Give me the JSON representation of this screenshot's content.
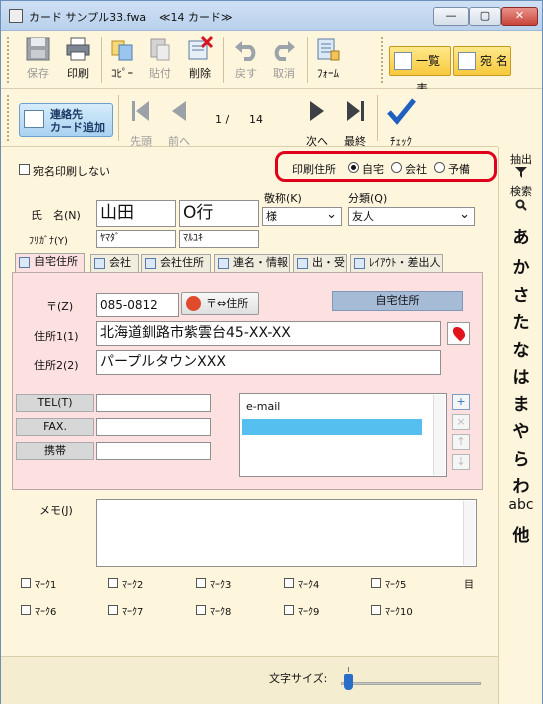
{
  "window": {
    "title": "カード サンプル33.fwa",
    "deck_label": "≪14 カード≫",
    "minimize_label": "—",
    "maximize_label": "▢",
    "close_label": "✕"
  },
  "toolbar": {
    "save": "保存",
    "print": "印刷",
    "copy": "ｺﾋﾟｰ",
    "paste": "貼付",
    "delete": "削除",
    "undo": "戻す",
    "cancel": "取消",
    "form": "ﾌｫｰﾑ",
    "list_view": "一覧表",
    "addressee": "宛 名"
  },
  "nav": {
    "add_card": "連絡先\nカード追加",
    "first": "先頭",
    "prev": "前へ",
    "position": "1 /",
    "total": "14",
    "next": "次へ",
    "last": "最終",
    "check": "ﾁｪｯｸ"
  },
  "rightbar": {
    "extract": "抽出",
    "search": "検索",
    "kana": [
      "あ",
      "か",
      "さ",
      "た",
      "な",
      "は",
      "ま",
      "や",
      "ら",
      "わ",
      "abc",
      "他"
    ]
  },
  "form": {
    "no_print_label": "宛名印刷しない",
    "print_address_label": "印刷住所",
    "radio_home": "自宅",
    "radio_company": "会社",
    "radio_spare": "予備",
    "honorific_label": "敬称(K)",
    "category_label": "分類(Q)",
    "name_label": "氏　名(N)",
    "furigana_label": "ﾌﾘｶﾞﾅ(Y)",
    "last_name": "山田",
    "first_name": "O行",
    "last_kana": "ﾔﾏﾀﾞ",
    "first_kana": "ﾏﾙﾕｷ",
    "honorific_value": "様",
    "category_value": "友人"
  },
  "tabs": [
    {
      "label": "自宅住所"
    },
    {
      "label": "会社"
    },
    {
      "label": "会社住所"
    },
    {
      "label": "連名・情報"
    },
    {
      "label": "出・受"
    },
    {
      "label": "ﾚｲｱｳﾄ・差出人"
    }
  ],
  "address": {
    "postal_label": "〒(Z)",
    "postal_value": "085-0812",
    "convert_button": "〒⇔住所",
    "home_chip": "自宅住所",
    "addr1_label": "住所1(1)",
    "addr1_value": "北海道釧路市紫雲台45-XX-XX",
    "addr2_label": "住所2(2)",
    "addr2_value": "パープルタウンXXX",
    "tel_label": "TEL(T)",
    "fax_label": "FAX.",
    "mobile_label": "携帯",
    "email_header": "e-mail"
  },
  "memo": {
    "label": "メモ(J)"
  },
  "marks": [
    "ﾏｰｸ1",
    "ﾏｰｸ2",
    "ﾏｰｸ3",
    "ﾏｰｸ4",
    "ﾏｰｸ5",
    "ﾏｰｸ6",
    "ﾏｰｸ7",
    "ﾏｰｸ8",
    "ﾏｰｸ9",
    "ﾏｰｸ10"
  ],
  "marks_icon": "目",
  "status": {
    "font_size_label": "文字サイズ:"
  }
}
